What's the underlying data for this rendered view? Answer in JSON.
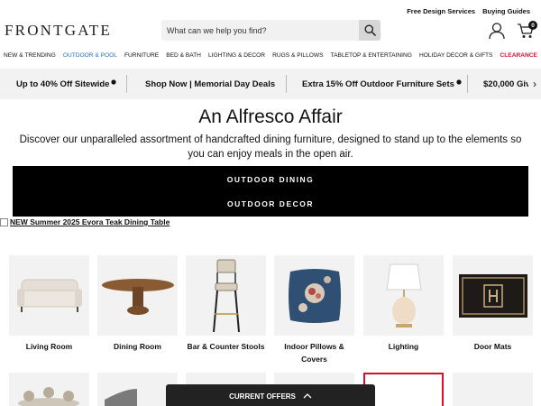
{
  "utility": {
    "design_services": "Free Design Services",
    "buying_guides": "Buying Guides"
  },
  "brand": {
    "logo": "FRONTGATE"
  },
  "search": {
    "placeholder": "What can we help you find?"
  },
  "cart": {
    "count": "0"
  },
  "nav": {
    "items": [
      "NEW & TRENDING",
      "OUTDOOR & POOL",
      "FURNITURE",
      "BED & BATH",
      "LIGHTING & DECOR",
      "RUGS & PILLOWS",
      "TABLETOP & ENTERTAINING",
      "HOLIDAY DECOR & GIFTS",
      "CLEARANCE"
    ]
  },
  "promos": {
    "p1": "Up to 40% Off Sitewide",
    "p2": "Shop Now | Memorial Day Deals",
    "p3": "Extra 15% Off Outdoor Furniture Sets",
    "p4": "$20,000 Giv"
  },
  "hero": {
    "title": "An Alfresco Affair",
    "subtitle": "Discover our unparalleled assortment of handcrafted dining furniture, designed to stand up to the elements so you can enjoy meals in the open air."
  },
  "cta": {
    "dining": "OUTDOOR DINING",
    "decor": "OUTDOOR DECOR"
  },
  "banner": {
    "alt_text": "NEW Summer 2025 Evora Teak Dining Table"
  },
  "categories": [
    {
      "label": "Living Room"
    },
    {
      "label": "Dining Room"
    },
    {
      "label": "Bar & Counter Stools"
    },
    {
      "label": "Indoor Pillows & Covers"
    },
    {
      "label": "Lighting"
    },
    {
      "label": "Door Mats"
    }
  ],
  "current_offers": {
    "label": "CURRENT OFFERS"
  },
  "colors": {
    "active_nav": "#1f6fd1",
    "clearance": "#d4112d",
    "cta_bg": "#000000",
    "tile_bg": "#f2f2f2"
  }
}
